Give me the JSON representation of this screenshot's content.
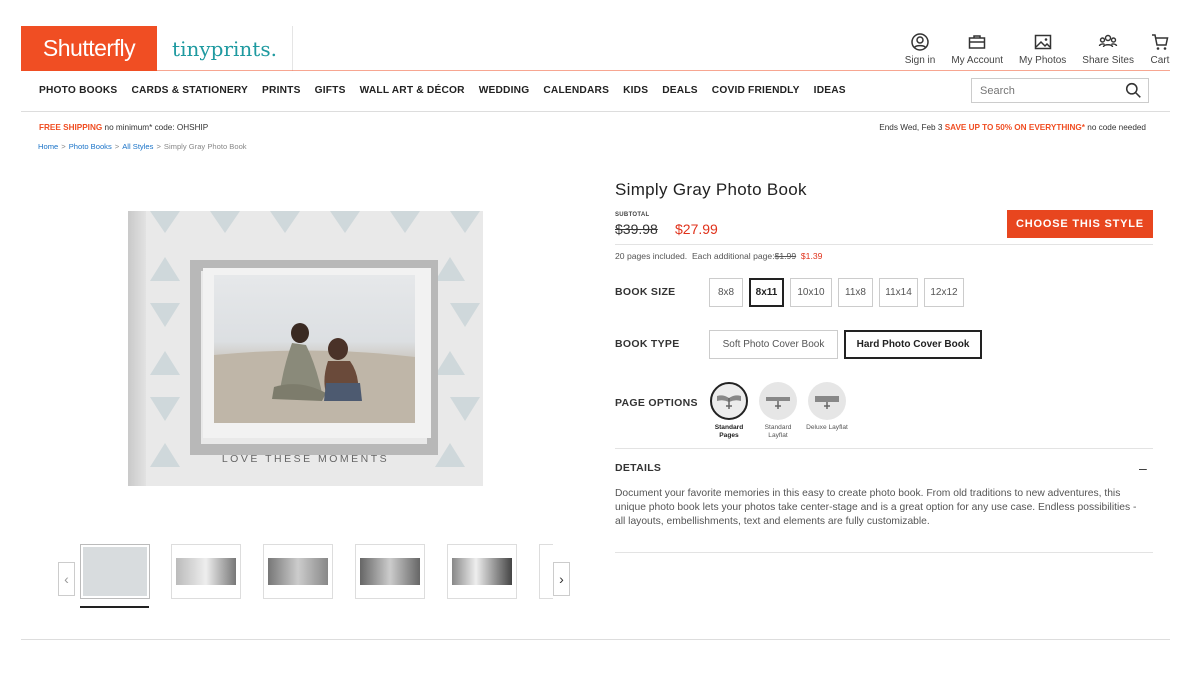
{
  "header": {
    "logo_shutterfly": "Shutterfly",
    "logo_tinyprints": "tinyprints.",
    "top_nav": [
      {
        "label": "Sign in",
        "icon": "user-circle-icon"
      },
      {
        "label": "My Account",
        "icon": "briefcase-icon"
      },
      {
        "label": "My Photos",
        "icon": "image-icon"
      },
      {
        "label": "Share Sites",
        "icon": "people-icon"
      },
      {
        "label": "Cart",
        "icon": "cart-icon"
      }
    ]
  },
  "main_nav": [
    "PHOTO BOOKS",
    "CARDS & STATIONERY",
    "PRINTS",
    "GIFTS",
    "WALL ART & DÉCOR",
    "WEDDING",
    "CALENDARS",
    "KIDS",
    "DEALS",
    "COVID FRIENDLY",
    "IDEAS"
  ],
  "search": {
    "placeholder": "Search"
  },
  "promo": {
    "left_highlight": "FREE SHIPPING",
    "left_text": " no minimum* code: OHSHIP",
    "right_prefix": "Ends Wed, Feb 3 ",
    "right_highlight": "SAVE UP TO 50% ON EVERYTHING*",
    "right_suffix": " no code needed"
  },
  "breadcrumb": [
    "Home",
    "Photo Books",
    "All Styles",
    "Simply Gray Photo Book"
  ],
  "book": {
    "caption": "LOVE THESE MOMENTS"
  },
  "product": {
    "title": "Simply Gray Photo Book",
    "subtotal_label": "SUBTOTAL",
    "price_old": "$39.98",
    "price_new": "$27.99",
    "choose_button": "CHOOSE THIS STYLE",
    "pages_included": "20 pages included.",
    "additional_label": "Each additional page:",
    "additional_old": "$1.99",
    "additional_new": "$1.39"
  },
  "book_size": {
    "label": "BOOK SIZE",
    "options": [
      "8x8",
      "8x11",
      "10x10",
      "11x8",
      "11x14",
      "12x12"
    ],
    "selected": "8x11"
  },
  "book_type": {
    "label": "BOOK TYPE",
    "options": [
      "Soft Photo Cover Book",
      "Hard Photo Cover Book"
    ],
    "selected": "Hard Photo Cover Book"
  },
  "page_options": {
    "label": "PAGE OPTIONS",
    "options": [
      "Standard Pages",
      "Standard Layflat",
      "Deluxe Layflat"
    ],
    "selected": "Standard Pages"
  },
  "details": {
    "label": "DETAILS",
    "toggle": "–",
    "text": "Document your favorite memories in this easy to create photo book. From old traditions to new adventures, this unique photo book lets your photos take center-stage and is a great option for any use case. Endless possibilities - all layouts, embellishments, text and elements are fully customizable."
  },
  "colors": {
    "brand": "#f04e23",
    "tinyprints": "#1f9aa0",
    "sale": "#e0321b",
    "link": "#1a73c8"
  }
}
